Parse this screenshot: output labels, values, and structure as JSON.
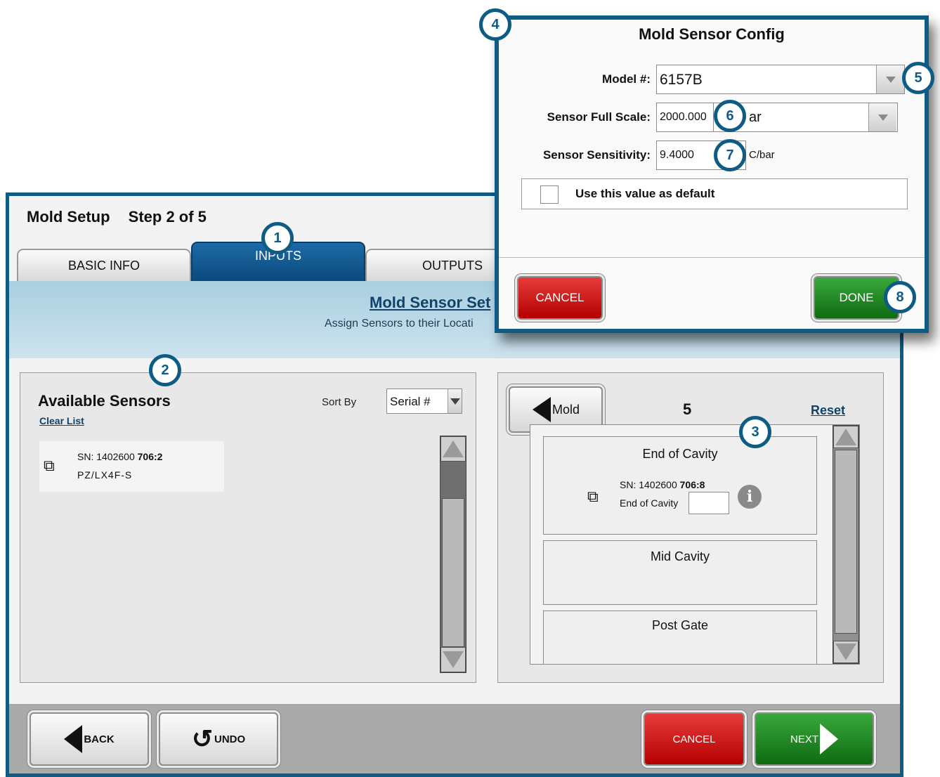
{
  "header": {
    "title": "Mold Setup",
    "step": "Step 2 of 5"
  },
  "tabs": [
    {
      "label": "BASIC INFO"
    },
    {
      "label": "INPUTS"
    },
    {
      "label": "OUTPUTS"
    }
  ],
  "banner": {
    "title": "Mold Sensor Set",
    "subtitle": "Assign Sensors to their Locati"
  },
  "available": {
    "title": "Available Sensors",
    "clear_label": "Clear List",
    "sort_label": "Sort By",
    "sort_value": "Serial #",
    "sensors": [
      {
        "sn_prefix": "SN: 1402600 ",
        "sn_bold": "706:2",
        "model": "PZ/LX4F-S"
      }
    ]
  },
  "mold": {
    "back_label": "Mold",
    "number": "5",
    "reset_label": "Reset",
    "cavities": [
      {
        "title": "End of Cavity",
        "sensor": {
          "sn_prefix": "SN: 1402600 ",
          "sn_bold": "706:8",
          "location": "End of Cavity"
        }
      },
      {
        "title": "Mid Cavity"
      },
      {
        "title": "Post Gate"
      }
    ]
  },
  "footer": {
    "back": "BACK",
    "undo": "UNDO",
    "cancel": "CANCEL",
    "next": "NEXT"
  },
  "dialog": {
    "title": "Mold Sensor Config",
    "model_label": "Model #:",
    "model_value": "6157B",
    "fullscale_label": "Sensor Full Scale:",
    "fullscale_value": "2000.000",
    "fullscale_unit": "ar",
    "sensitivity_label": "Sensor Sensitivity:",
    "sensitivity_value": "9.4000",
    "sensitivity_unit": "C/bar",
    "default_label": "Use this value as default",
    "default_checked": false,
    "cancel": "CANCEL",
    "done": "DONE"
  },
  "callouts": [
    "1",
    "2",
    "3",
    "4",
    "5",
    "6",
    "7",
    "8"
  ],
  "colors": {
    "brand_blue": "#0e5c84",
    "tab_active": "#0b4a7d",
    "red": "#c40000",
    "green": "#1f8a22"
  },
  "icons": {
    "sensor": "sensor-icon",
    "info": "info-icon",
    "undo": "undo-icon",
    "back": "back-arrow-icon",
    "next": "next-arrow-icon"
  }
}
